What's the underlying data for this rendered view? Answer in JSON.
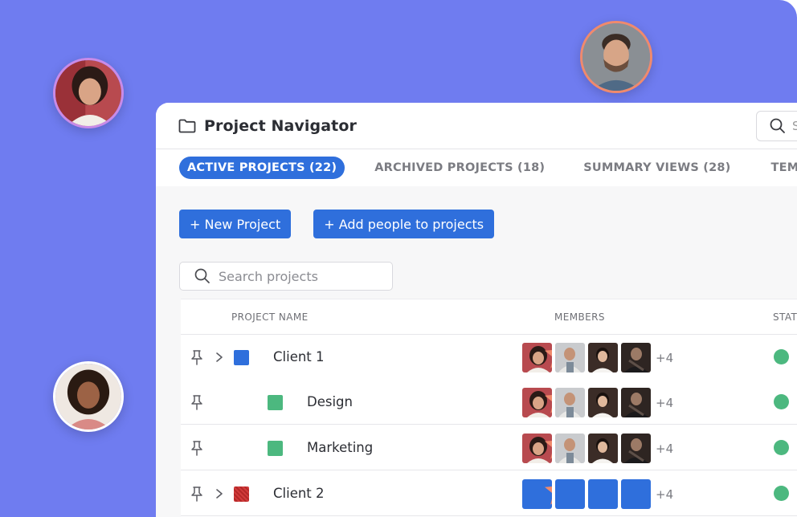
{
  "app": {
    "title": "Project Navigator",
    "top_search_letter": "S"
  },
  "tabs": [
    {
      "label": "ACTIVE PROJECTS (22)",
      "active": true
    },
    {
      "label": "ARCHIVED PROJECTS (18)",
      "active": false
    },
    {
      "label": "SUMMARY VIEWS (28)",
      "active": false
    },
    {
      "label": "TEMPL",
      "active": false
    }
  ],
  "actions": {
    "new_project": "+ New Project",
    "add_people": "+ Add people to projects"
  },
  "search": {
    "placeholder": "Search projects"
  },
  "table": {
    "headers": {
      "name": "PROJECT NAME",
      "members": "MEMBERS",
      "status": "STAT"
    },
    "rows": [
      {
        "name": "Client 1",
        "level": 0,
        "expandable": true,
        "color": "#2f6fdc",
        "more": "+4",
        "status_color": "#4cb87f"
      },
      {
        "name": "Design",
        "level": 1,
        "expandable": false,
        "color": "#4cb87f",
        "more": "+4",
        "status_color": "#4cb87f"
      },
      {
        "name": "Marketing",
        "level": 1,
        "expandable": false,
        "color": "#4cb87f",
        "more": "+4",
        "status_color": "#4cb87f"
      },
      {
        "name": "Client 2",
        "level": 0,
        "expandable": true,
        "color": "#d23b3b",
        "more": "+4",
        "status_color": "#4cb87f"
      }
    ]
  },
  "colors": {
    "background": "#6f7cf0",
    "accent": "#2f6fdc",
    "status_green": "#4cb87f",
    "star": "#f08a6c"
  }
}
